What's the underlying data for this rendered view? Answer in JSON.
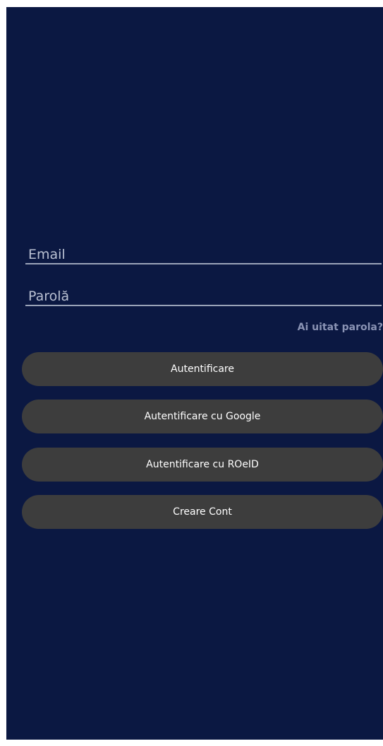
{
  "form": {
    "email_placeholder": "Email",
    "password_placeholder": "Parolă",
    "forgot_password": "Ai uitat parola?"
  },
  "buttons": {
    "login": "Autentificare",
    "google_login": "Autentificare cu Google",
    "roeid_login": "Autentificare cu ROeID",
    "create_account": "Creare Cont"
  },
  "colors": {
    "background": "#0b1842",
    "button": "#3d3d3d",
    "field_underline": "#9aa3b8",
    "link": "#8a93b4"
  }
}
